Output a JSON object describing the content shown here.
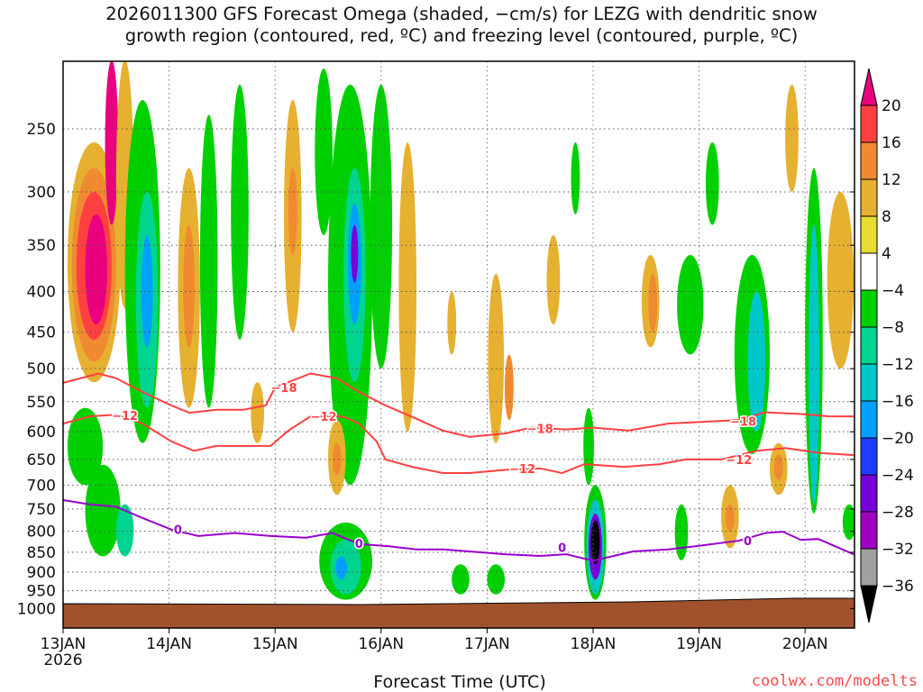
{
  "chart_data": {
    "type": "heatmap",
    "title_line1": "2026011300 GFS Forecast Omega (shaded, −cm/s) for LEZG with dendritic snow",
    "title_line2": "growth region (contoured, red, ºC) and freezing level (contoured, purple, ºC)",
    "xlabel": "Forecast Time (UTC)",
    "ylabel": "",
    "credit": "coolwx.com/modelts",
    "x_range_hours": [
      0,
      180
    ],
    "y_range_hpa": [
      205,
      1058
    ],
    "x_ticks": [
      {
        "h": 0,
        "label": "13JAN",
        "sub": "2026"
      },
      {
        "h": 24,
        "label": "14JAN"
      },
      {
        "h": 48,
        "label": "15JAN"
      },
      {
        "h": 72,
        "label": "16JAN"
      },
      {
        "h": 96,
        "label": "17JAN"
      },
      {
        "h": 120,
        "label": "18JAN"
      },
      {
        "h": 144,
        "label": "19JAN"
      },
      {
        "h": 168,
        "label": "20JAN"
      }
    ],
    "y_ticks": [
      250,
      300,
      350,
      400,
      450,
      500,
      550,
      600,
      650,
      700,
      750,
      800,
      850,
      900,
      950,
      1000
    ],
    "colorbar": {
      "levels": [
        "20",
        "16",
        "12",
        "8",
        "4",
        "−4",
        "−8",
        "−12",
        "−16",
        "−20",
        "−24",
        "−28",
        "−32",
        "−36"
      ],
      "colors": [
        "#ff4040",
        "#f08a30",
        "#e6b030",
        "#e8dc30",
        "#ffffff",
        "#00d000",
        "#00d490",
        "#00c8c8",
        "#00a0ff",
        "#1e3cff",
        "#7800d8",
        "#a000c0",
        "#a0a0a0"
      ],
      "over_color": "#e8007f",
      "under_color": "#000000"
    },
    "surface_hpa": 981,
    "terrain_color": "#a0522d",
    "contours": [
      {
        "name": "-18 C",
        "color": "#ff4040",
        "labels": [
          {
            "h": 50,
            "p": 528,
            "t": "−18"
          },
          {
            "h": 108,
            "p": 594,
            "t": "−18"
          },
          {
            "h": 154,
            "p": 582,
            "t": "−18"
          }
        ],
        "h": [
          0,
          4,
          8,
          12,
          18,
          24.5,
          28.6,
          34.7,
          40.8,
          45.9,
          48,
          56,
          62,
          67,
          73,
          80,
          86,
          92,
          100,
          106,
          114,
          120,
          128,
          137,
          145,
          153,
          159,
          167,
          173.5,
          179
        ],
        "p": [
          521,
          514,
          507,
          514,
          535,
          556,
          568,
          563,
          563,
          556,
          528,
          507,
          514,
          535,
          556,
          578,
          598,
          609,
          603,
          593,
          596,
          593,
          598,
          586,
          583,
          580,
          567,
          570,
          574,
          574
        ]
      },
      {
        "name": "-12 C",
        "color": "#ff4040",
        "labels": [
          {
            "h": 14,
            "p": 572,
            "t": "−12"
          },
          {
            "h": 59,
            "p": 574,
            "t": "−12"
          },
          {
            "h": 104,
            "p": 667,
            "t": "−12"
          },
          {
            "h": 153,
            "p": 650,
            "t": "−12"
          }
        ],
        "h": [
          0,
          6,
          12,
          18,
          24.5,
          29.6,
          34.7,
          40.8,
          47,
          51,
          56,
          63.3,
          67,
          71,
          73,
          79,
          86,
          92,
          100,
          108,
          113,
          118,
          127,
          135,
          141,
          149,
          157,
          163.5,
          171.5,
          179
        ],
        "p": [
          586,
          574,
          571,
          586,
          617,
          634,
          625,
          625,
          625,
          598,
          574,
          574,
          586,
          617,
          650,
          664,
          676,
          676,
          670,
          667,
          676,
          659,
          664,
          659,
          650,
          650,
          634,
          629,
          638,
          642
        ]
      },
      {
        "name": "0 C",
        "color": "#9a00d0",
        "labels": [
          {
            "h": 26,
            "p": 796,
            "t": "0"
          },
          {
            "h": 67,
            "p": 828,
            "t": "0"
          },
          {
            "h": 113,
            "p": 838,
            "t": "0"
          },
          {
            "h": 155,
            "p": 822,
            "t": "0"
          }
        ],
        "h": [
          0,
          6,
          12,
          18,
          24.5,
          30.6,
          38.8,
          47,
          55,
          61,
          67,
          73.5,
          80,
          86,
          92,
          100,
          108,
          114,
          120,
          129,
          137,
          145,
          153,
          159,
          163,
          167,
          171,
          179
        ],
        "p": [
          731,
          740,
          745,
          770,
          796,
          811,
          804,
          811,
          815,
          804,
          830,
          835,
          843,
          843,
          848,
          855,
          859,
          855,
          871,
          848,
          843,
          833,
          822,
          804,
          801,
          820,
          818,
          855
        ]
      }
    ],
    "omega_features": [
      {
        "h": 7,
        "dh": 6,
        "p1": 260,
        "p2": 520,
        "v": 8
      },
      {
        "h": 7,
        "dh": 5,
        "p1": 280,
        "p2": 490,
        "v": 12
      },
      {
        "h": 7,
        "dh": 4,
        "p1": 300,
        "p2": 460,
        "v": 16
      },
      {
        "h": 7.5,
        "dh": 2.5,
        "p1": 320,
        "p2": 440,
        "v": 20
      },
      {
        "h": 11,
        "dh": 1.5,
        "p1": 205,
        "p2": 330,
        "v": 20
      },
      {
        "h": 14,
        "dh": 2,
        "p1": 205,
        "p2": 420,
        "v": 8
      },
      {
        "h": 18,
        "dh": 4,
        "p1": 230,
        "p2": 620,
        "v": -8
      },
      {
        "h": 19,
        "dh": 2.5,
        "p1": 300,
        "p2": 560,
        "v": -12
      },
      {
        "h": 19,
        "dh": 1.3,
        "p1": 340,
        "p2": 470,
        "v": -20
      },
      {
        "h": 5,
        "dh": 4,
        "p1": 560,
        "p2": 700,
        "v": -8
      },
      {
        "h": 9,
        "dh": 4,
        "p1": 660,
        "p2": 860,
        "v": -8
      },
      {
        "h": 14,
        "dh": 2,
        "p1": 740,
        "p2": 860,
        "v": -12
      },
      {
        "h": 28.5,
        "dh": 2.5,
        "p1": 280,
        "p2": 560,
        "v": 8
      },
      {
        "h": 28.5,
        "dh": 1.3,
        "p1": 330,
        "p2": 470,
        "v": 12
      },
      {
        "h": 33,
        "dh": 2,
        "p1": 240,
        "p2": 560,
        "v": -8
      },
      {
        "h": 40,
        "dh": 2,
        "p1": 220,
        "p2": 460,
        "v": -8
      },
      {
        "h": 52,
        "dh": 2,
        "p1": 230,
        "p2": 450,
        "v": 8
      },
      {
        "h": 52,
        "dh": 1,
        "p1": 280,
        "p2": 360,
        "v": 12
      },
      {
        "h": 59,
        "dh": 2,
        "p1": 210,
        "p2": 340,
        "v": -8
      },
      {
        "h": 65,
        "dh": 5,
        "p1": 220,
        "p2": 700,
        "v": -8
      },
      {
        "h": 66,
        "dh": 2.5,
        "p1": 280,
        "p2": 520,
        "v": -12
      },
      {
        "h": 66,
        "dh": 1.5,
        "p1": 310,
        "p2": 440,
        "v": -20
      },
      {
        "h": 66,
        "dh": 0.8,
        "p1": 330,
        "p2": 390,
        "v": -28
      },
      {
        "h": 62,
        "dh": 2,
        "p1": 580,
        "p2": 720,
        "v": 8
      },
      {
        "h": 62,
        "dh": 1,
        "p1": 620,
        "p2": 680,
        "v": 12
      },
      {
        "h": 64,
        "dh": 6,
        "p1": 780,
        "p2": 975,
        "v": -8
      },
      {
        "h": 64,
        "dh": 3.5,
        "p1": 820,
        "p2": 960,
        "v": -12
      },
      {
        "h": 63,
        "dh": 1.3,
        "p1": 860,
        "p2": 920,
        "v": -20
      },
      {
        "h": 72,
        "dh": 2.5,
        "p1": 220,
        "p2": 500,
        "v": -8
      },
      {
        "h": 78,
        "dh": 2,
        "p1": 260,
        "p2": 600,
        "v": 8
      },
      {
        "h": 90,
        "dh": 2,
        "p1": 880,
        "p2": 960,
        "v": -8
      },
      {
        "h": 98,
        "dh": 2,
        "p1": 880,
        "p2": 960,
        "v": -8
      },
      {
        "h": 98,
        "dh": 1.8,
        "p1": 380,
        "p2": 620,
        "v": 8
      },
      {
        "h": 101,
        "dh": 1,
        "p1": 480,
        "p2": 580,
        "v": 12
      },
      {
        "h": 111,
        "dh": 1.5,
        "p1": 340,
        "p2": 440,
        "v": 8
      },
      {
        "h": 120.5,
        "dh": 2.5,
        "p1": 700,
        "p2": 975,
        "v": -8
      },
      {
        "h": 120.5,
        "dh": 2,
        "p1": 730,
        "p2": 960,
        "v": -16
      },
      {
        "h": 120.5,
        "dh": 1.5,
        "p1": 760,
        "p2": 920,
        "v": -28
      },
      {
        "h": 120.5,
        "dh": 1,
        "p1": 775,
        "p2": 880,
        "v": -36
      },
      {
        "h": 119,
        "dh": 1.2,
        "p1": 560,
        "p2": 700,
        "v": -8
      },
      {
        "h": 116,
        "dh": 1,
        "p1": 260,
        "p2": 320,
        "v": -8
      },
      {
        "h": 133,
        "dh": 2,
        "p1": 360,
        "p2": 470,
        "v": 8
      },
      {
        "h": 133.5,
        "dh": 1,
        "p1": 380,
        "p2": 450,
        "v": 12
      },
      {
        "h": 142,
        "dh": 3,
        "p1": 360,
        "p2": 480,
        "v": -8
      },
      {
        "h": 140,
        "dh": 1.5,
        "p1": 740,
        "p2": 870,
        "v": -8
      },
      {
        "h": 151,
        "dh": 2,
        "p1": 700,
        "p2": 840,
        "v": 8
      },
      {
        "h": 151,
        "dh": 1,
        "p1": 740,
        "p2": 800,
        "v": 12
      },
      {
        "h": 156,
        "dh": 4,
        "p1": 360,
        "p2": 640,
        "v": -8
      },
      {
        "h": 157,
        "dh": 2,
        "p1": 400,
        "p2": 600,
        "v": -16
      },
      {
        "h": 162,
        "dh": 2,
        "p1": 620,
        "p2": 720,
        "v": 8
      },
      {
        "h": 162,
        "dh": 1,
        "p1": 640,
        "p2": 690,
        "v": 12
      },
      {
        "h": 170,
        "dh": 2,
        "p1": 280,
        "p2": 760,
        "v": -8
      },
      {
        "h": 170,
        "dh": 1.2,
        "p1": 330,
        "p2": 740,
        "v": -16
      },
      {
        "h": 176,
        "dh": 3,
        "p1": 300,
        "p2": 500,
        "v": 8
      },
      {
        "h": 178,
        "dh": 1.5,
        "p1": 740,
        "p2": 820,
        "v": -8
      },
      {
        "h": 88,
        "dh": 1,
        "p1": 400,
        "p2": 480,
        "v": 8
      },
      {
        "h": 44,
        "dh": 1.5,
        "p1": 520,
        "p2": 620,
        "v": 8
      },
      {
        "h": 147,
        "dh": 1.5,
        "p1": 260,
        "p2": 330,
        "v": -8
      },
      {
        "h": 165,
        "dh": 1.5,
        "p1": 220,
        "p2": 300,
        "v": 8
      }
    ]
  }
}
